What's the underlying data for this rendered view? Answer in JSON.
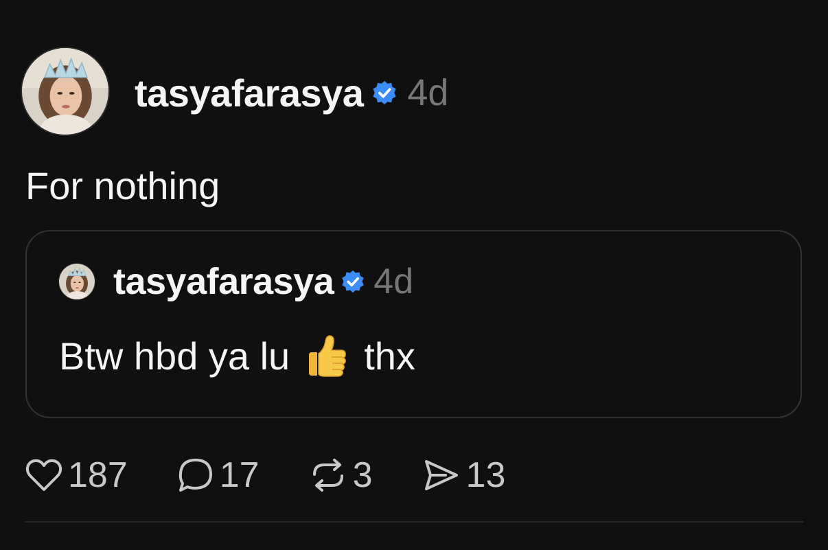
{
  "post": {
    "author": {
      "username": "tasyafarasya",
      "verified": true,
      "timestamp": "4d",
      "avatar_icon": "profile-photo"
    },
    "text": "For nothing",
    "quoted": {
      "author": {
        "username": "tasyafarasya",
        "verified": true,
        "timestamp": "4d"
      },
      "text_before": "Btw hbd ya lu",
      "emoji": "thumbs-up",
      "text_after": "thx"
    },
    "actions": {
      "likes": "187",
      "replies": "17",
      "reposts": "3",
      "shares": "13"
    }
  },
  "colors": {
    "background": "#101010",
    "text": "#f3f5f7",
    "muted": "#777777",
    "verified": "#3b8cf7",
    "border": "#333333"
  }
}
